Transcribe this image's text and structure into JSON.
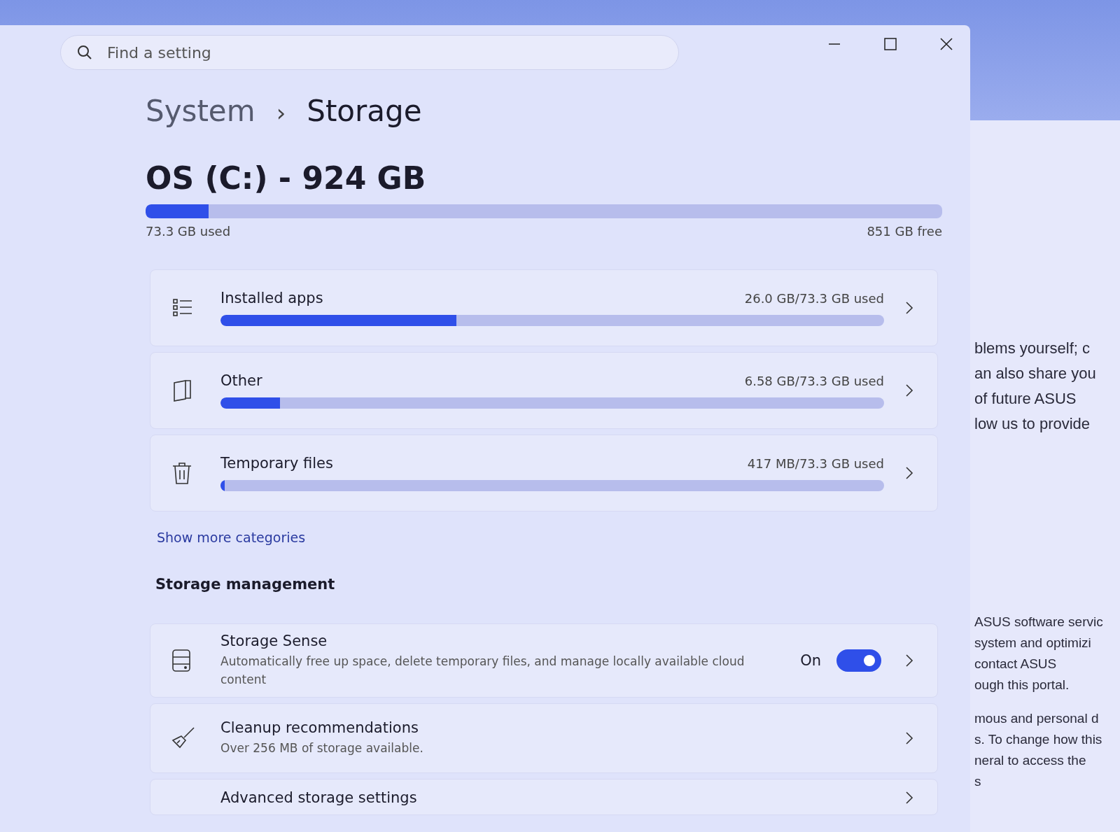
{
  "search": {
    "placeholder": "Find a setting"
  },
  "breadcrumb": {
    "parent": "System",
    "separator": "›",
    "current": "Storage"
  },
  "drive": {
    "title": "OS (C:) - 924 GB",
    "level": 0.079,
    "used": "73.3 GB used",
    "free": "851 GB free"
  },
  "categories": [
    {
      "label": "Installed apps",
      "usage": "26.0 GB/73.3 GB used",
      "level": 0.355
    },
    {
      "label": "Other",
      "usage": "6.58 GB/73.3 GB used",
      "level": 0.09
    },
    {
      "label": "Temporary files",
      "usage": "417 MB/73.3 GB used",
      "level": 0.006
    }
  ],
  "show_more": "Show more categories",
  "section_title": "Storage management",
  "management": [
    {
      "kind": "toggle",
      "title": "Storage Sense",
      "description": "Automatically free up space, delete temporary files, and manage locally available cloud content",
      "state_label": "On",
      "on": true
    },
    {
      "kind": "link",
      "title": "Cleanup recommendations",
      "description": "Over 256 MB of storage available."
    },
    {
      "kind": "link",
      "title": "Advanced storage settings"
    }
  ],
  "background_window": {
    "paragraphs": [
      {
        "lines": [
          "blems yourself; c",
          "an also share you",
          "of future ASUS",
          "low us to provide"
        ]
      },
      {
        "lines": [
          "ASUS software servic",
          "system and optimizi",
          "contact ASUS",
          "ough this portal."
        ]
      },
      {
        "lines": [
          "mous and personal d",
          "s. To change how this",
          "neral to access the",
          "s"
        ]
      }
    ]
  }
}
